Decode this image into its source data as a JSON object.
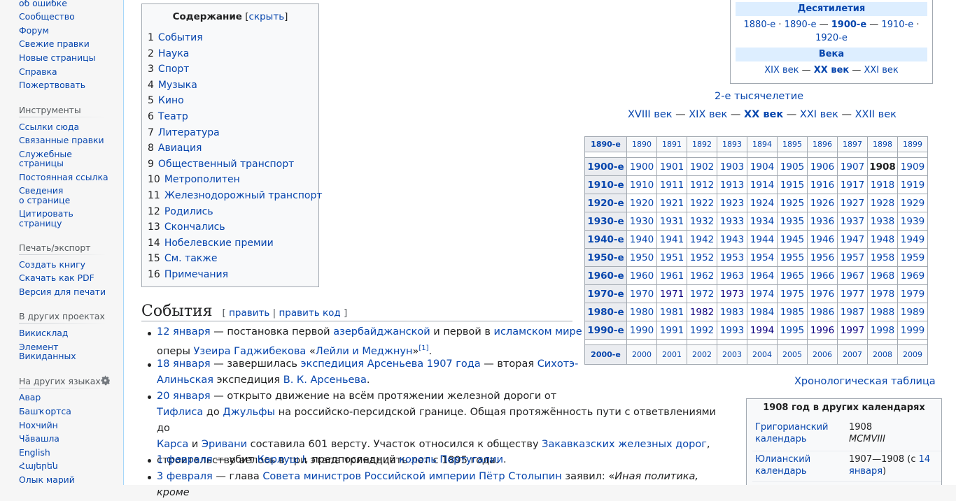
{
  "sidebar": {
    "top_items": [
      "об ошибке",
      "Сообщество",
      "Форум",
      "Свежие правки",
      "Новые страницы",
      "Справка",
      "Пожертвовать"
    ],
    "tools_heading": "Инструменты",
    "tools_items": [
      "Ссылки сюда",
      "Связанные правки",
      "Служебные",
      "страницы",
      "Постоянная ссылка",
      "Сведения",
      "о странице",
      "Цитировать",
      "страницу"
    ],
    "print_heading": "Печать/экспорт",
    "print_items": [
      "Создать книгу",
      "Скачать как PDF",
      "Версия для печати"
    ],
    "projects_heading": "В других проектах",
    "projects_items": [
      "Викисклад",
      "Элемент",
      "Викиданных"
    ],
    "langs_heading": "На других языках",
    "langs_items": [
      "Авар",
      "Башҡортса",
      "Нохчийн",
      "Чӑвашла",
      "English",
      "Հայերեն",
      "Олык марий"
    ]
  },
  "toc": {
    "title": "Содержание",
    "hide_label": "скрыть",
    "items": [
      {
        "num": "1",
        "label": "События"
      },
      {
        "num": "2",
        "label": "Наука"
      },
      {
        "num": "3",
        "label": "Спорт"
      },
      {
        "num": "4",
        "label": "Музыка"
      },
      {
        "num": "5",
        "label": "Кино"
      },
      {
        "num": "6",
        "label": "Театр"
      },
      {
        "num": "7",
        "label": "Литература"
      },
      {
        "num": "8",
        "label": "Авиация"
      },
      {
        "num": "9",
        "label": "Общественный транспорт"
      },
      {
        "num": "10",
        "label": "Метрополитен"
      },
      {
        "num": "11",
        "label": "Железнодорожный транспорт"
      },
      {
        "num": "12",
        "label": "Родились"
      },
      {
        "num": "13",
        "label": "Скончались"
      },
      {
        "num": "14",
        "label": "Нобелевские премии"
      },
      {
        "num": "15",
        "label": "См. также"
      },
      {
        "num": "16",
        "label": "Примечания"
      }
    ]
  },
  "decades_box": {
    "decades_heading": "Десятилетия",
    "dec_1880": "1880-е",
    "dec_1890": "1890-е",
    "dec_1900": "1900-е",
    "dec_1910": "1910-е",
    "dec_1920": "1920-е",
    "centuries_heading": "Века",
    "c19": "XIX век",
    "c20": "XX век",
    "c21": "XXI век"
  },
  "millennium": "2-е тысячелетие",
  "centuries_line": {
    "c18": "XVIII век",
    "c19": "XIX век",
    "c20": "XX век",
    "c21": "XXI век",
    "c22": "XXII век"
  },
  "years_table": {
    "top_row": [
      "1890-е",
      "1890",
      "1891",
      "1892",
      "1893",
      "1894",
      "1895",
      "1896",
      "1897",
      "1898",
      "1899"
    ],
    "rows": [
      [
        "1900-е",
        "1900",
        "1901",
        "1902",
        "1903",
        "1904",
        "1905",
        "1906",
        "1907",
        "1908",
        "1909"
      ],
      [
        "1910-е",
        "1910",
        "1911",
        "1912",
        "1913",
        "1914",
        "1915",
        "1916",
        "1917",
        "1918",
        "1919"
      ],
      [
        "1920-е",
        "1920",
        "1921",
        "1922",
        "1923",
        "1924",
        "1925",
        "1926",
        "1927",
        "1928",
        "1929"
      ],
      [
        "1930-е",
        "1930",
        "1931",
        "1932",
        "1933",
        "1934",
        "1935",
        "1936",
        "1937",
        "1938",
        "1939"
      ],
      [
        "1940-е",
        "1940",
        "1941",
        "1942",
        "1943",
        "1944",
        "1945",
        "1946",
        "1947",
        "1948",
        "1949"
      ],
      [
        "1950-е",
        "1950",
        "1951",
        "1952",
        "1953",
        "1954",
        "1955",
        "1956",
        "1957",
        "1958",
        "1959"
      ],
      [
        "1960-е",
        "1960",
        "1961",
        "1962",
        "1963",
        "1964",
        "1965",
        "1966",
        "1967",
        "1968",
        "1969"
      ],
      [
        "1970-е",
        "1970",
        "1971",
        "1972",
        "1973",
        "1974",
        "1975",
        "1976",
        "1977",
        "1978",
        "1979"
      ],
      [
        "1980-е",
        "1980",
        "1981",
        "1982",
        "1983",
        "1984",
        "1985",
        "1986",
        "1987",
        "1988",
        "1989"
      ],
      [
        "1990-е",
        "1990",
        "1991",
        "1992",
        "1993",
        "1994",
        "1995",
        "1996",
        "1997",
        "1998",
        "1999"
      ]
    ],
    "bottom_row": [
      "2000-е",
      "2000",
      "2001",
      "2002",
      "2003",
      "2004",
      "2005",
      "2006",
      "2007",
      "2008",
      "2009"
    ],
    "current_year": "1908"
  },
  "chron_table_link": "Хронологическая таблица",
  "calendars": {
    "caption": "1908 год в других календарях",
    "greg_label_1": "Григорианский",
    "greg_label_2": "календарь",
    "greg_val_1": "1908",
    "greg_val_2": "MCMVIII",
    "jul_label_1": "Юлианский",
    "jul_label_2": "календарь",
    "jul_val_1": "1907—1908 (с ",
    "jul_val_link": "14",
    "jul_val_2": "января",
    "jul_val_3": ")"
  },
  "section": {
    "heading": "События",
    "edit": "править",
    "edit_code": "править код"
  },
  "events": {
    "e1_date": "12 января",
    "e1_t1": " — постановка первой ",
    "e1_l1": "азербайджанской",
    "e1_t2": " и первой в ",
    "e1_l2": "исламском мире",
    "e1_t3": "оперы ",
    "e1_l3": "Узеира Гаджибекова",
    "e1_t4": " «",
    "e1_l4": "Лейли и Меджнун",
    "e1_t5": "»",
    "e1_ref": "[1]",
    "e1_t6": ".",
    "e2_date": "18 января",
    "e2_t1": " — завершилась ",
    "e2_l1": "экспедиция Арсеньева 1907 года",
    "e2_t2": " — вторая ",
    "e2_l2a": "Сихотэ-",
    "e2_l2b": "Алиньская",
    "e2_t3": " экспедиция ",
    "e2_l3": "В. К. Арсеньева",
    "e2_t4": ".",
    "e3_date": "20 января",
    "e3_t1": " — открыто движение на всём протяжении железной дороги от",
    "e3_l1": "Тифлиса",
    "e3_t2": " до ",
    "e3_l2": "Джульфы",
    "e3_t3": " на российско-персидской границе. Общая протяжённость пути с ответвлениями до",
    "e3_l3": "Карса",
    "e3_t4": " и ",
    "e3_l4": "Эривани",
    "e3_t5": " составила 601 версту. Участок относился к обществу ",
    "e3_l5": "Закавказских железных дорог",
    "e3_t6": ",",
    "e3_t7": "строительство велось в три этапа тринадцать лет с 1895 года.",
    "e4_date": "1 февраля",
    "e4_t1": " — убит ",
    "e4_l1": "Карлуш I",
    "e4_t2": ", предпоследний ",
    "e4_l2": "король Португалии",
    "e4_t3": ".",
    "e5_date": "3 февраля",
    "e5_t1": " — глава ",
    "e5_l1": "Совета министров Российской империи",
    "e5_t2": " ",
    "e5_l2": "Пётр Столыпин",
    "e5_t3": " заявил: «",
    "e5_t4": "Иная политика, кроме"
  }
}
